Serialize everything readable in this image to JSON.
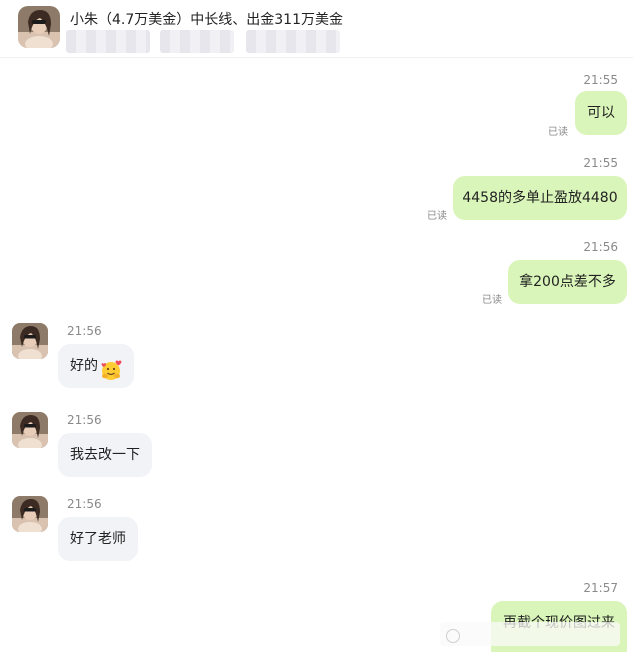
{
  "header": {
    "title": "小朱（4.7万美金）中长线、出金311万美金",
    "avatar": "contact-avatar"
  },
  "messages": [
    {
      "time": "21:55",
      "from": "me",
      "text": "可以",
      "status": "已读"
    },
    {
      "time": "21:55",
      "from": "me",
      "text": "4458的多单止盈放4480",
      "status": "已读"
    },
    {
      "time": "21:56",
      "from": "me",
      "text": "拿200点差不多",
      "status": "已读"
    },
    {
      "time": "21:56",
      "from": "contact",
      "text": "好的",
      "emoji": "hugging-face-hearts-emoji"
    },
    {
      "time": "21:56",
      "from": "contact",
      "text": "我去改一下"
    },
    {
      "time": "21:56",
      "from": "contact",
      "text": "好了老师"
    },
    {
      "time": "21:57",
      "from": "me",
      "text": "再截个现价图过来"
    }
  ],
  "colors": {
    "outgoing_bubble": "#d9f5b9",
    "incoming_bubble": "#f2f3f7",
    "timestamp": "#8a8a8a"
  }
}
